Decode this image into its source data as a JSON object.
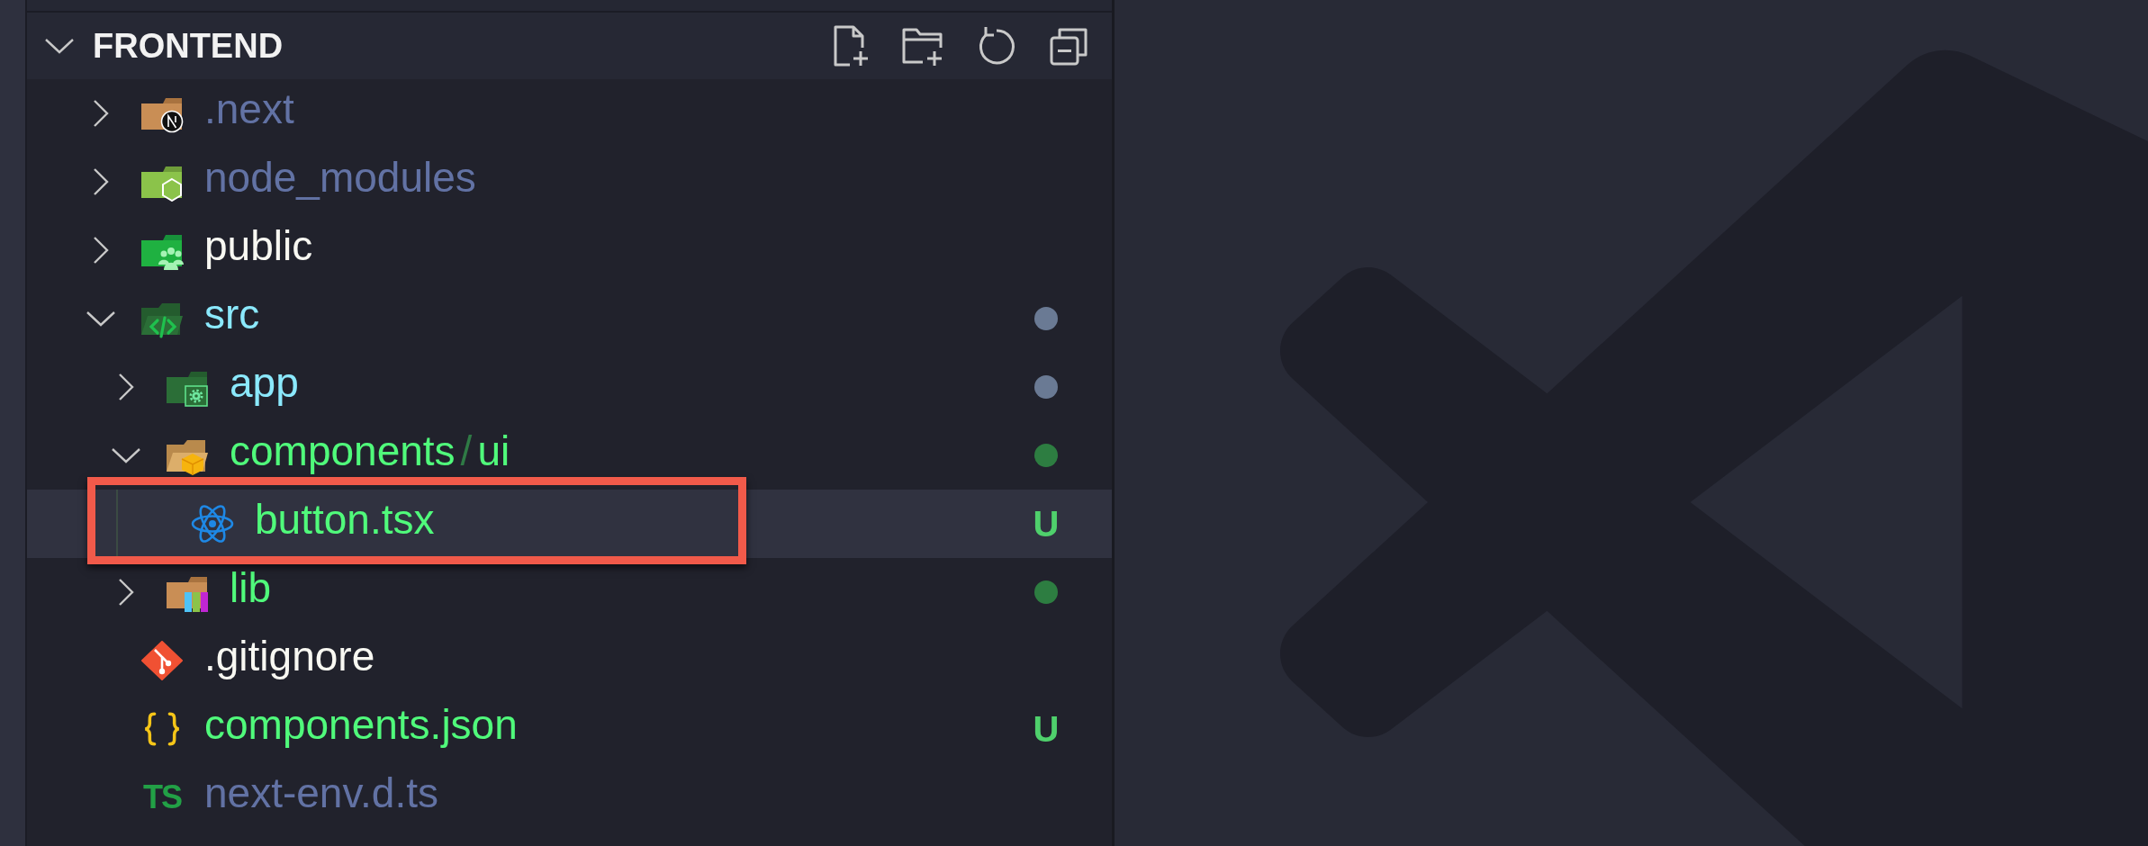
{
  "section": {
    "title": "FRONTEND",
    "expanded": true
  },
  "tree": [
    {
      "kind": "folder",
      "name": ".next",
      "expanded": false,
      "selected": false,
      "outlined": false,
      "color": "#6272a4"
    },
    {
      "kind": "folder",
      "name": "node_modules",
      "expanded": false,
      "selected": false,
      "outlined": false,
      "color": "#6272a4"
    },
    {
      "kind": "folder",
      "name": "public",
      "expanded": false,
      "selected": false,
      "outlined": false,
      "color": "#f8f8f2"
    },
    {
      "kind": "folder",
      "name": "src",
      "expanded": true,
      "selected": false,
      "outlined": false,
      "color": "#8be9fd",
      "decoration": {
        "kind": "dot",
        "color": "#6a7a94"
      },
      "children": [
        {
          "kind": "folder",
          "name": "app",
          "expanded": false,
          "selected": false,
          "outlined": false,
          "color": "#8be9fd",
          "decoration": {
            "kind": "dot",
            "color": "#6a7a94"
          }
        },
        {
          "kind": "folder",
          "name_parts": [
            "components",
            "ui"
          ],
          "separator": "/",
          "expanded": true,
          "selected": false,
          "outlined": false,
          "color": "#50fa7b",
          "decoration": {
            "kind": "dot",
            "color": "#2d7d41"
          },
          "children": [
            {
              "kind": "file",
              "name": "button.tsx",
              "selected": true,
              "outlined": true,
              "color": "#50fa7b",
              "decoration": {
                "kind": "letter",
                "text": "U",
                "color": "#4fd06c"
              }
            }
          ]
        },
        {
          "kind": "folder",
          "name": "lib",
          "expanded": false,
          "selected": false,
          "outlined": false,
          "color": "#50fa7b",
          "decoration": {
            "kind": "dot",
            "color": "#2d7d41"
          }
        }
      ]
    },
    {
      "kind": "file",
      "name": ".gitignore",
      "selected": false,
      "outlined": false,
      "color": "#f8f8f2"
    },
    {
      "kind": "file",
      "name": "components.json",
      "selected": false,
      "outlined": false,
      "color": "#50fa7b",
      "decoration": {
        "kind": "letter",
        "text": "U",
        "color": "#4fd06c"
      }
    },
    {
      "kind": "file",
      "name": "next-env.d.ts",
      "icon_text": "TS",
      "selected": false,
      "outlined": false,
      "color": "#6272a4"
    }
  ]
}
